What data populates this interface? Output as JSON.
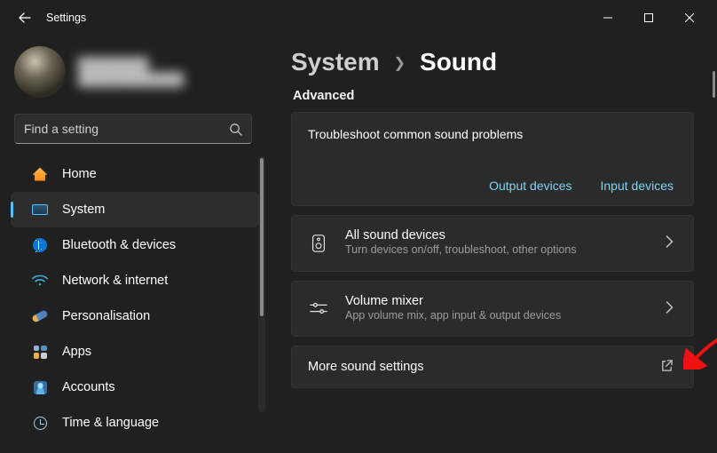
{
  "window": {
    "title": "Settings"
  },
  "sidebar": {
    "profile": {
      "name": "████████",
      "email": "████████████"
    },
    "search": {
      "placeholder": "Find a setting"
    },
    "items": [
      {
        "label": "Home"
      },
      {
        "label": "System"
      },
      {
        "label": "Bluetooth & devices"
      },
      {
        "label": "Network & internet"
      },
      {
        "label": "Personalisation"
      },
      {
        "label": "Apps"
      },
      {
        "label": "Accounts"
      },
      {
        "label": "Time & language"
      }
    ]
  },
  "breadcrumb": {
    "parent": "System",
    "current": "Sound"
  },
  "section_label": "Advanced",
  "troubleshoot": {
    "title": "Troubleshoot common sound problems",
    "output": "Output devices",
    "input": "Input devices"
  },
  "rows": {
    "all_devices": {
      "title": "All sound devices",
      "sub": "Turn devices on/off, troubleshoot, other options"
    },
    "mixer": {
      "title": "Volume mixer",
      "sub": "App volume mix, app input & output devices"
    },
    "more": {
      "title": "More sound settings"
    }
  }
}
